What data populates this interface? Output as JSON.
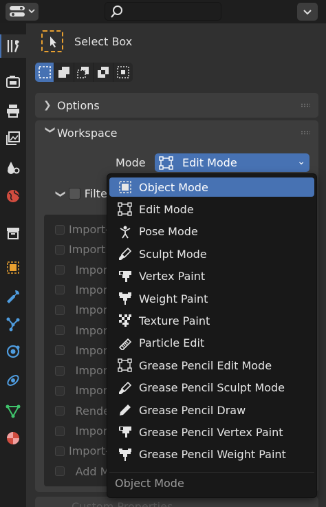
{
  "header": {
    "editor_type_icon": "properties-editor-icon",
    "search_icon": "search-icon",
    "menu_icon": "chevron-down-icon"
  },
  "tabs": [
    {
      "name": "tool",
      "icon": "wrench-screwdriver-icon",
      "active": true
    },
    {
      "name": "render",
      "icon": "camera-back-icon"
    },
    {
      "name": "output",
      "icon": "printer-icon"
    },
    {
      "name": "view-layer",
      "icon": "image-stack-icon"
    },
    {
      "name": "scene",
      "icon": "scene-icon"
    },
    {
      "name": "world",
      "icon": "globe-icon"
    },
    {
      "name": "collection",
      "icon": "box-icon"
    },
    {
      "name": "object",
      "icon": "object-square-icon"
    },
    {
      "name": "modifiers",
      "icon": "wrench-icon"
    },
    {
      "name": "particles",
      "icon": "particles-icon"
    },
    {
      "name": "physics",
      "icon": "physics-orbit-icon"
    },
    {
      "name": "constraints",
      "icon": "constraint-icon"
    },
    {
      "name": "data",
      "icon": "mesh-triangle-icon"
    },
    {
      "name": "material",
      "icon": "material-sphere-icon"
    }
  ],
  "tool": {
    "name": "Select Box",
    "icon": "select-box-cursor-icon"
  },
  "selection_modes": [
    {
      "icon": "mode-set-icon",
      "active": true
    },
    {
      "icon": "mode-extend-icon"
    },
    {
      "icon": "mode-subtract-icon"
    },
    {
      "icon": "mode-invert-icon"
    },
    {
      "icon": "mode-intersect-icon"
    }
  ],
  "panels": {
    "options": {
      "title": "Options",
      "collapsed": true
    },
    "workspace": {
      "title": "Workspace",
      "collapsed": false
    }
  },
  "workspace": {
    "mode_label": "Mode",
    "mode_value": "Edit Mode",
    "filter_label": "Filte"
  },
  "addons_visible": [
    "Import-",
    "Import",
    "Impor",
    "Impor",
    "Impor",
    "Impor",
    "Impor",
    "Impor",
    "Import",
    "Rende",
    "Impor",
    "Import-",
    "Add M"
  ],
  "bottom_panel_partial": "Custom Properties",
  "menu": {
    "items": [
      {
        "label": "Object Mode",
        "icon": "object-mode-icon",
        "highlighted": true
      },
      {
        "label": "Edit Mode",
        "icon": "edit-mode-icon"
      },
      {
        "label": "Pose Mode",
        "icon": "pose-mode-icon"
      },
      {
        "label": "Sculpt Mode",
        "icon": "sculpt-brush-icon"
      },
      {
        "label": "Vertex Paint",
        "icon": "vertex-paint-icon"
      },
      {
        "label": "Weight Paint",
        "icon": "weight-paint-icon"
      },
      {
        "label": "Texture Paint",
        "icon": "texture-paint-icon"
      },
      {
        "label": "Particle Edit",
        "icon": "comb-icon"
      },
      {
        "label": "Grease Pencil Edit Mode",
        "icon": "edit-mode-icon"
      },
      {
        "label": "Grease Pencil Sculpt Mode",
        "icon": "sculpt-brush-icon"
      },
      {
        "label": "Grease Pencil Draw",
        "icon": "pencil-icon"
      },
      {
        "label": "Grease Pencil Vertex Paint",
        "icon": "vertex-paint-icon"
      },
      {
        "label": "Grease Pencil Weight Paint",
        "icon": "weight-paint-icon"
      }
    ],
    "footer": "Object Mode"
  },
  "colors": {
    "accent": "#4772b3",
    "tool_outline": "#e8a030"
  }
}
